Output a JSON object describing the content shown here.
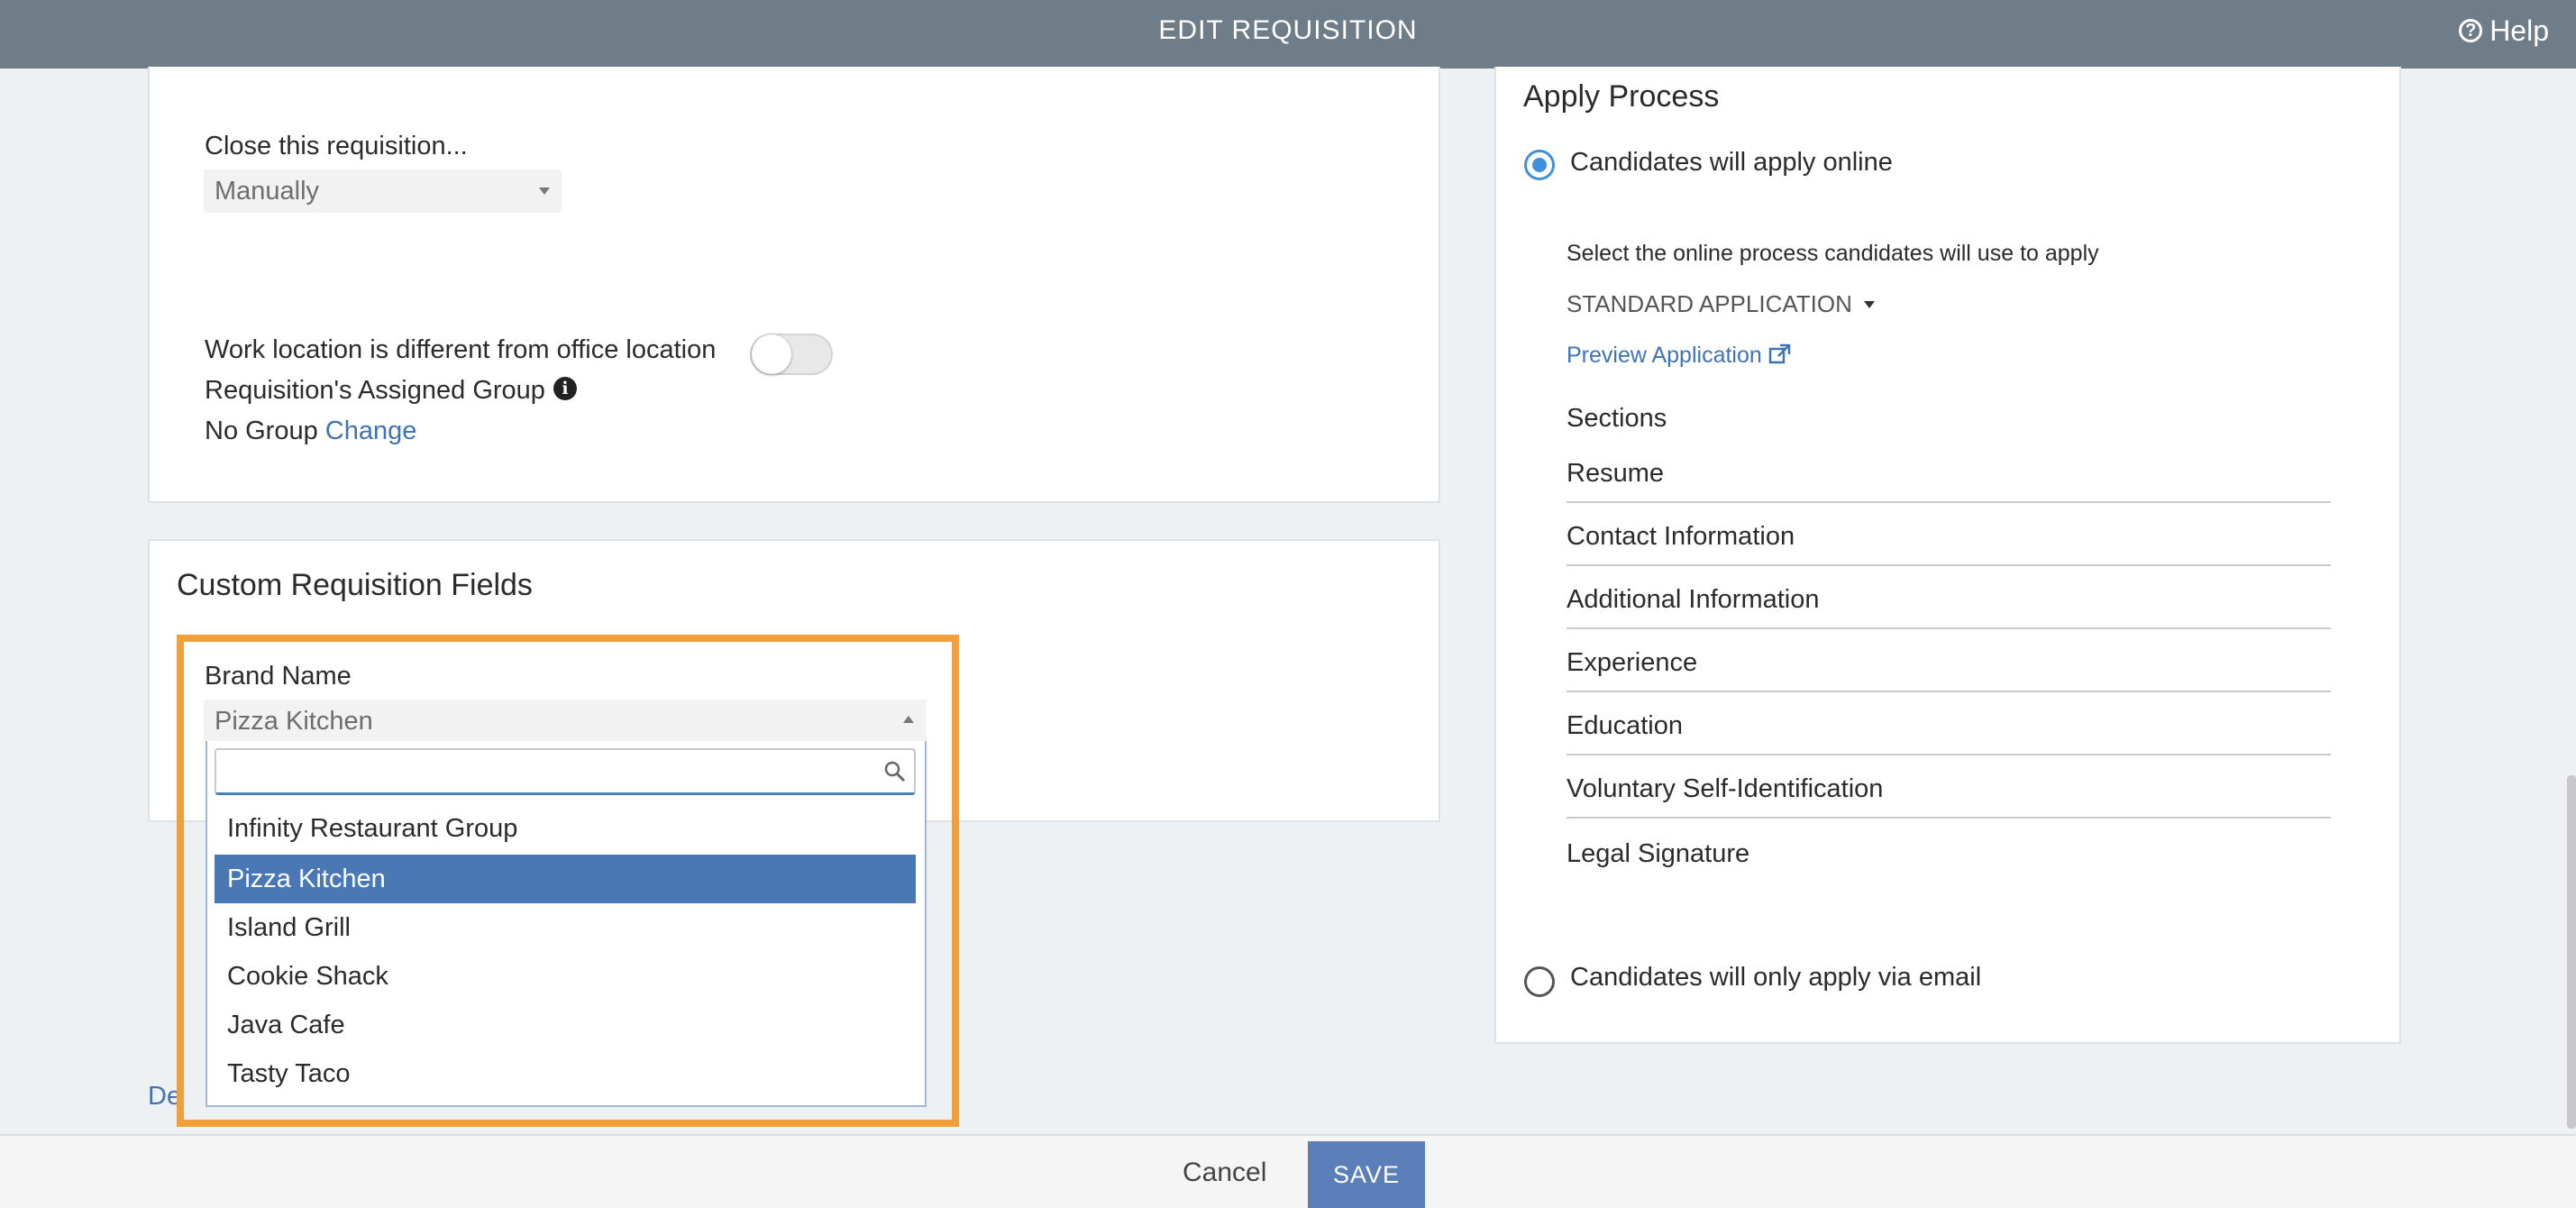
{
  "header": {
    "title": "EDIT REQUISITION",
    "help_label": "Help"
  },
  "left_panel": {
    "close_label": "Close this requisition...",
    "close_value": "Manually",
    "work_location_label": "Work location is different from office location",
    "work_location_toggle": false,
    "assigned_group_label": "Requisition's Assigned Group",
    "group_value": "No Group",
    "change_link": "Change"
  },
  "custom_fields": {
    "title": "Custom Requisition Fields",
    "brand_label": "Brand Name",
    "brand_value": "Pizza Kitchen",
    "search_placeholder": "",
    "options": [
      "Infinity Restaurant Group",
      "Pizza Kitchen",
      "Island Grill",
      "Cookie Shack",
      "Java Cafe",
      "Tasty Taco"
    ],
    "selected_index": 1,
    "delete_link_partial": "De"
  },
  "apply_process": {
    "title": "Apply Process",
    "online_label": "Candidates will apply online",
    "online_selected": true,
    "select_process_label": "Select the online process candidates will use to apply",
    "process_value": "STANDARD APPLICATION",
    "preview_link": "Preview Application",
    "sections_title": "Sections",
    "sections": [
      "Resume",
      "Contact Information",
      "Additional Information",
      "Experience",
      "Education",
      "Voluntary Self-Identification",
      "Legal Signature"
    ],
    "email_label": "Candidates will only apply via email",
    "email_selected": false
  },
  "footer": {
    "cancel_label": "Cancel",
    "save_label": "SAVE"
  },
  "colors": {
    "header_bg": "#6f7d88",
    "accent": "#3f73b4",
    "highlight": "#f0a03a",
    "save_bg": "#5b7fb8",
    "selected_option": "#4a78b5"
  }
}
